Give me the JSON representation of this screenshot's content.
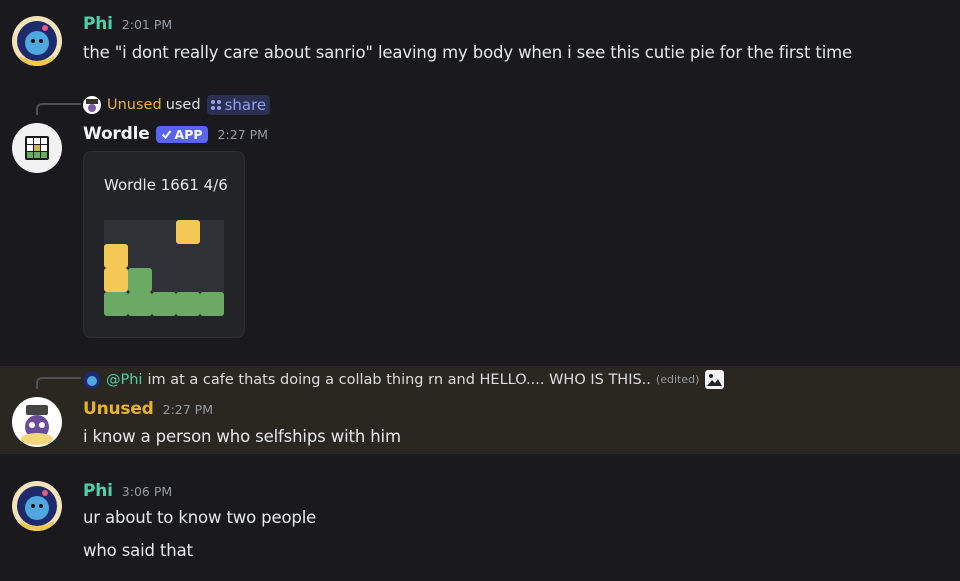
{
  "messages": {
    "m1": {
      "author": "Phi",
      "time": "2:01 PM",
      "text": "the \"i dont really care about sanrio\" leaving my body when i see this cutie pie for the first time"
    },
    "m2": {
      "reply": {
        "user": "Unused",
        "used": "used",
        "command": "share"
      },
      "author": "Wordle",
      "badge": "APP",
      "time": "2:27 PM",
      "card_title": "Wordle 1661 4/6"
    },
    "m3": {
      "reply": {
        "mention": "@Phi",
        "text": "im at a cafe thats doing a collab thing rn and HELLO.... WHO IS THIS..",
        "edited": "(edited)"
      },
      "author": "Unused",
      "time": "2:27 PM",
      "text": "i know a person who selfships with him"
    },
    "m4": {
      "author": "Phi",
      "time": "3:06 PM",
      "lines": [
        "ur about to know two people",
        "who said that"
      ]
    }
  },
  "wordle_grid": [
    [
      "empty",
      "empty",
      "empty",
      "yellow",
      "empty"
    ],
    [
      "yellow",
      "empty",
      "empty",
      "empty",
      "empty"
    ],
    [
      "yellow",
      "green",
      "empty",
      "empty",
      "empty"
    ],
    [
      "green",
      "green",
      "green",
      "green",
      "green"
    ]
  ],
  "colors": {
    "phi": "#4fd1a6",
    "unused": "#e8b22e",
    "green": "#6aaa64",
    "yellow": "#f5c755",
    "empty": "#2f3136"
  }
}
